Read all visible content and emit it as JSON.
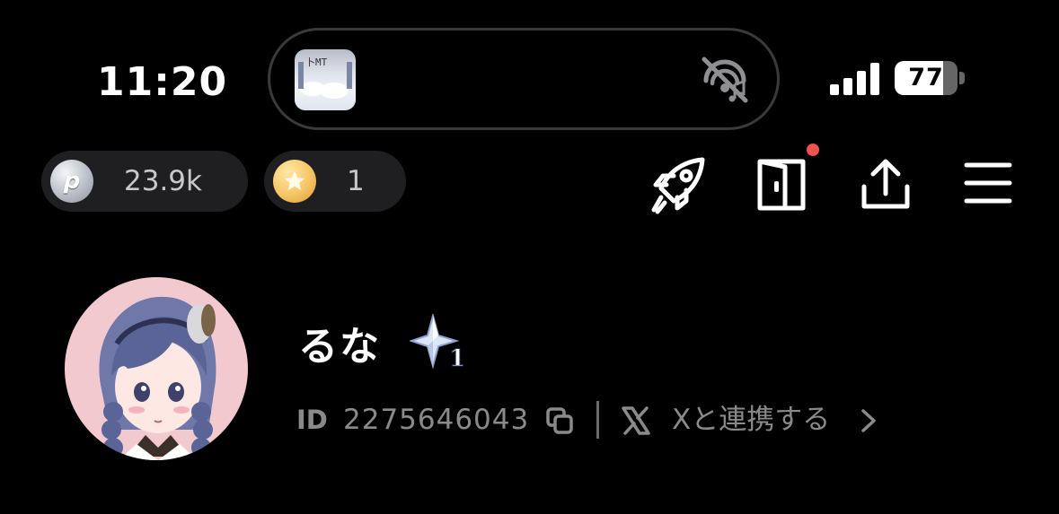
{
  "status_bar": {
    "time": "11:20",
    "battery_level": 77,
    "battery_label": "77",
    "island_thumbnail_text": "卜MT"
  },
  "currencies": {
    "points_value": "23.9k",
    "coins_value": "1",
    "points_icon": "p-coin-icon",
    "coins_icon": "star-coin-icon"
  },
  "toolbar": {
    "icons": [
      "rocket-icon",
      "door-icon",
      "share-icon",
      "menu-icon"
    ],
    "door_has_notification": true
  },
  "profile": {
    "username": "るな",
    "rank_number": "1",
    "id_label": "ID",
    "id_value": "2275646043",
    "x_link_label": "Xと連携する"
  },
  "colors": {
    "background": "#000000",
    "pill_background": "#1f1f21",
    "notification_dot": "#ef5350",
    "secondary_text": "#8a8a8a",
    "avatar_background": "#f3c9d0"
  }
}
